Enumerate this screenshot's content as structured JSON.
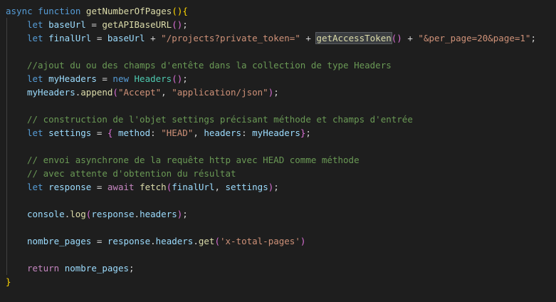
{
  "code": {
    "l1": {
      "kw_async": "async",
      "kw_function": "function",
      "name": "getNumberOfPages",
      "open": "()",
      "brace": "{"
    },
    "l2": {
      "kw_let": "let",
      "var": "baseUrl",
      "eq": " = ",
      "call": "getAPIBaseURL",
      "parens": "()",
      "semi": ";"
    },
    "l3": {
      "kw_let": "let",
      "var": "finalUrl",
      "eq": " = ",
      "base": "baseUrl",
      "plus1": " + ",
      "str1": "\"/projects?private_token=\"",
      "plus2": " + ",
      "call": "getAccessToken",
      "parens": "()",
      "plus3": " + ",
      "str2": "\"&per_page=20&page=1\"",
      "semi": ";"
    },
    "l5": {
      "comment": "//ajout du ou des champs d'entête dans la collection de type Headers"
    },
    "l6": {
      "kw_let": "let",
      "var": "myHeaders",
      "eq": " = ",
      "kw_new": "new",
      "cls": "Headers",
      "parens": "()",
      "semi": ";"
    },
    "l7": {
      "obj": "myHeaders",
      "dot": ".",
      "method": "append",
      "open": "(",
      "str1": "\"Accept\"",
      "comma": ", ",
      "str2": "\"application/json\"",
      "close": ")",
      "semi": ";"
    },
    "l9": {
      "comment": "// construction de l'objet settings précisant méthode et champs d'entrée"
    },
    "l10": {
      "kw_let": "let",
      "var": "settings",
      "eq": " = ",
      "open": "{",
      "key1": " method",
      "colon1": ": ",
      "str1": "\"HEAD\"",
      "comma": ", ",
      "key2": "headers",
      "colon2": ": ",
      "val2": "myHeaders",
      "close": "}",
      "semi": ";"
    },
    "l12": {
      "comment": "// envoi asynchrone de la requête http avec HEAD comme méthode"
    },
    "l13": {
      "comment": "// avec attente d'obtention du résultat"
    },
    "l14": {
      "kw_let": "let",
      "var": "response",
      "eq": " = ",
      "kw_await": "await",
      "fn": "fetch",
      "open": "(",
      "arg1": "finalUrl",
      "comma": ", ",
      "arg2": "settings",
      "close": ")",
      "semi": ";"
    },
    "l16": {
      "obj": "console",
      "dot1": ".",
      "method": "log",
      "open": "(",
      "arg": "response",
      "dot2": ".",
      "prop": "headers",
      "close": ")",
      "semi": ";"
    },
    "l18": {
      "var": "nombre_pages",
      "eq": " = ",
      "obj": "response",
      "dot1": ".",
      "prop": "headers",
      "dot2": ".",
      "method": "get",
      "open": "(",
      "str": "'x-total-pages'",
      "close": ")"
    },
    "l20": {
      "kw_return": "return",
      "var": "nombre_pages",
      "semi": ";"
    },
    "l21": {
      "brace": "}"
    }
  }
}
